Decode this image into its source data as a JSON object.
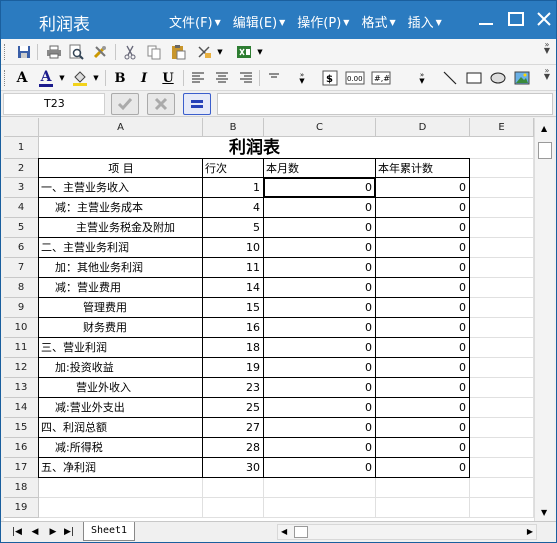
{
  "app": {
    "title": "利润表"
  },
  "menu": [
    {
      "label": "文件(F)"
    },
    {
      "label": "编辑(E)"
    },
    {
      "label": "操作(P)"
    },
    {
      "label": "格式"
    },
    {
      "label": "插入"
    }
  ],
  "formula_bar": {
    "cell_ref": "T23",
    "formula": ""
  },
  "columns": [
    "A",
    "B",
    "C",
    "D",
    "E"
  ],
  "rows": [
    "1",
    "2",
    "3",
    "4",
    "5",
    "6",
    "7",
    "8",
    "9",
    "10",
    "11",
    "12",
    "13",
    "14",
    "15",
    "16",
    "17",
    "18",
    "19"
  ],
  "sheet": {
    "title": "利润表",
    "headers": {
      "item": "项        目",
      "line_no": "行次",
      "this_month": "本月数",
      "ytd": "本年累计数"
    },
    "lines": [
      {
        "item": "一、主营业务收入",
        "line": "1",
        "month": "0",
        "ytd": "0"
      },
      {
        "item": "    减：主营业务成本",
        "line": "4",
        "month": "0",
        "ytd": "0"
      },
      {
        "item": "          主营业务税金及附加",
        "line": "5",
        "month": "0",
        "ytd": "0"
      },
      {
        "item": "二、主营业务利润",
        "line": "10",
        "month": "0",
        "ytd": "0"
      },
      {
        "item": "    加：其他业务利润",
        "line": "11",
        "month": "0",
        "ytd": "0"
      },
      {
        "item": "    减：营业费用",
        "line": "14",
        "month": "0",
        "ytd": "0"
      },
      {
        "item": "            管理费用",
        "line": "15",
        "month": "0",
        "ytd": "0"
      },
      {
        "item": "            财务费用",
        "line": "16",
        "month": "0",
        "ytd": "0"
      },
      {
        "item": "三、营业利润",
        "line": "18",
        "month": "0",
        "ytd": "0"
      },
      {
        "item": "    加:投资收益",
        "line": "19",
        "month": "0",
        "ytd": "0"
      },
      {
        "item": "          营业外收入",
        "line": "23",
        "month": "0",
        "ytd": "0"
      },
      {
        "item": "    减:营业外支出",
        "line": "25",
        "month": "0",
        "ytd": "0"
      },
      {
        "item": "四、利润总额",
        "line": "27",
        "month": "0",
        "ytd": "0"
      },
      {
        "item": "    减:所得税",
        "line": "28",
        "month": "0",
        "ytd": "0"
      },
      {
        "item": "五、净利润",
        "line": "30",
        "month": "0",
        "ytd": "0"
      }
    ]
  },
  "sheet_tabs": [
    {
      "label": "Sheet1"
    }
  ],
  "colors": {
    "titlebar": "#2b7bc0",
    "grid_line": "#e0e0e0",
    "border": "#000000"
  }
}
